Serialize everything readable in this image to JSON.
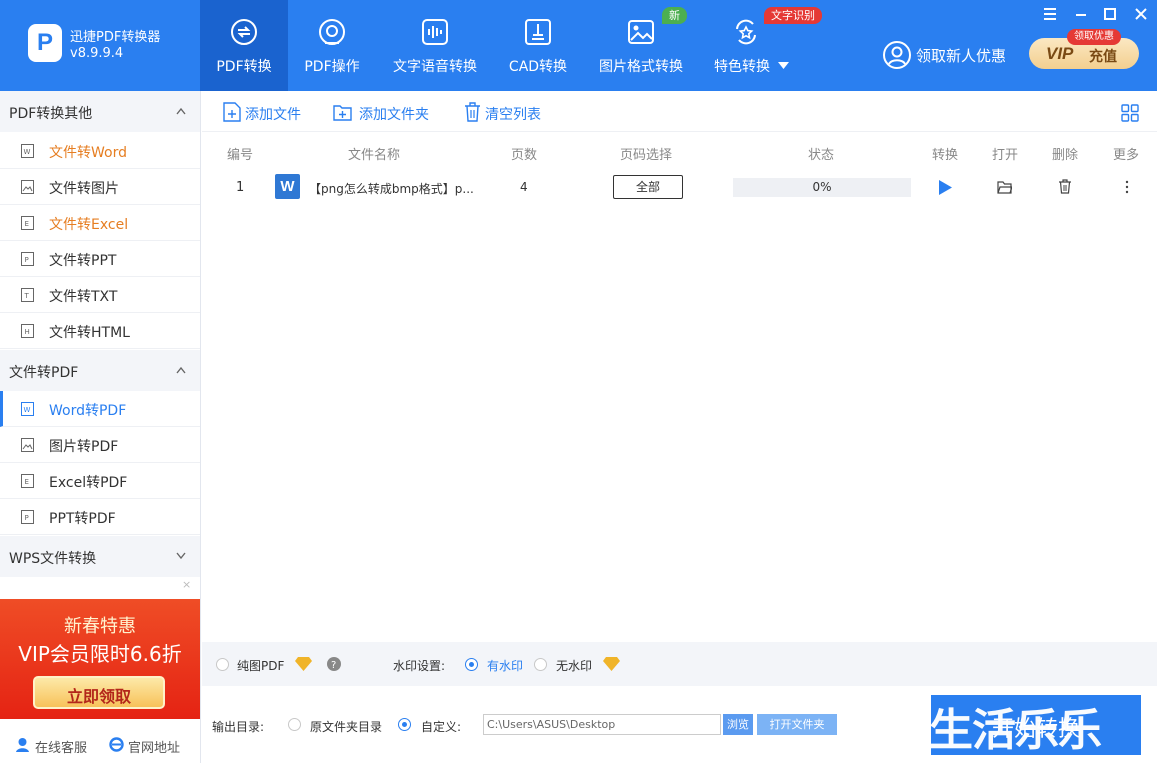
{
  "app": {
    "title": "迅捷PDF转换器",
    "version": "v8.9.9.4"
  },
  "nav": [
    {
      "label": "PDF转换",
      "icon": "pdf-convert-icon"
    },
    {
      "label": "PDF操作",
      "icon": "pdf-operate-icon"
    },
    {
      "label": "文字语音转换",
      "icon": "voice-icon"
    },
    {
      "label": "CAD转换",
      "icon": "cad-icon"
    },
    {
      "label": "图片格式转换",
      "icon": "image-icon",
      "tag": "新"
    },
    {
      "label": "特色转换",
      "icon": "special-icon",
      "tag": "文字识别"
    }
  ],
  "promo": {
    "label": "领取新人优惠",
    "vip_label": "VIP",
    "vip_action": "充值",
    "vip_tag": "领取优惠"
  },
  "colors": {
    "primary": "#2a7ff0",
    "active_nav": "#1a63cf",
    "highlight_text": "#e67e22",
    "tag_new": "#4caf50",
    "tag_ocr": "#e53935"
  },
  "sidebar": {
    "groups": [
      {
        "label": "PDF转换其他",
        "items": [
          "文件转Word",
          "文件转图片",
          "文件转Excel",
          "文件转PPT",
          "文件转TXT",
          "文件转HTML"
        ]
      },
      {
        "label": "文件转PDF",
        "items": [
          "Word转PDF",
          "图片转PDF",
          "Excel转PDF",
          "PPT转PDF"
        ]
      },
      {
        "label": "WPS文件转换",
        "items": []
      }
    ],
    "banner": {
      "line1": "新春特惠",
      "line2": "VIP会员限时6.6折",
      "button": "立即领取",
      "close": "×"
    },
    "footer": {
      "service": "在线客服",
      "website": "官网地址"
    }
  },
  "toolbar": {
    "add_file": "添加文件",
    "add_folder": "添加文件夹",
    "clear_list": "清空列表"
  },
  "table": {
    "headers": [
      "编号",
      "文件名称",
      "页数",
      "页码选择",
      "状态",
      "转换",
      "打开",
      "删除",
      "更多"
    ],
    "rows": [
      {
        "index": "1",
        "filename": "【png怎么转成bmp格式】p...",
        "pages": "4",
        "range": "全部",
        "status": "0%",
        "progress": 0
      }
    ]
  },
  "options": {
    "pure_pdf": "纯图PDF",
    "watermark_label": "水印设置:",
    "watermark_on": "有水印",
    "watermark_off": "无水印"
  },
  "output": {
    "label": "输出目录:",
    "original_dir": "原文件夹目录",
    "custom": "自定义:",
    "path": "C:\\Users\\ASUS\\Desktop",
    "browse": "浏览",
    "open_folder": "打开文件夹"
  },
  "start_button": "开始转换",
  "watermark_overlay": "生活乐乐"
}
